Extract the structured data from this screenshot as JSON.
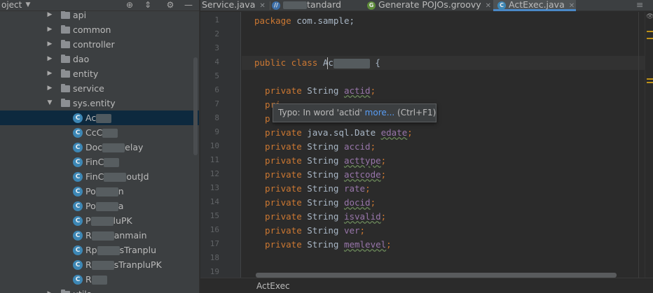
{
  "project_panel": {
    "title": "oject",
    "tree": [
      {
        "kind": "folder",
        "label": "api",
        "expanded": false
      },
      {
        "kind": "folder",
        "label": "common",
        "expanded": false
      },
      {
        "kind": "folder",
        "label": "controller",
        "expanded": false
      },
      {
        "kind": "folder",
        "label": "dao",
        "expanded": false
      },
      {
        "kind": "folder",
        "label": "entity",
        "expanded": false
      },
      {
        "kind": "folder",
        "label": "service",
        "expanded": false
      },
      {
        "kind": "folder",
        "label": "sys.entity",
        "expanded": true
      },
      {
        "kind": "class",
        "label": "Ac",
        "selected": true
      },
      {
        "kind": "class",
        "label": "CcC"
      },
      {
        "kind": "class",
        "label": "Doc",
        "suffix": "elay"
      },
      {
        "kind": "class",
        "label": "FinC"
      },
      {
        "kind": "class",
        "label": "FinC",
        "suffix": "outJd"
      },
      {
        "kind": "class",
        "label": "Po",
        "suffix": "n"
      },
      {
        "kind": "class",
        "label": "Po",
        "suffix": "a"
      },
      {
        "kind": "class",
        "label": "P",
        "suffix": "luPK"
      },
      {
        "kind": "class",
        "label": "R",
        "suffix": "anmain"
      },
      {
        "kind": "class",
        "label": "Rp",
        "suffix": "sTranplu"
      },
      {
        "kind": "class",
        "label": "R",
        "suffix": "sTranpluPK"
      },
      {
        "kind": "class",
        "label": "R"
      },
      {
        "kind": "folder",
        "label": "utils",
        "expanded": false
      }
    ]
  },
  "tabs": [
    {
      "label": "Service.java",
      "icon": "none",
      "active": false
    },
    {
      "label": "tandard",
      "icon": "class-icon",
      "active": false
    },
    {
      "label": "Generate POJOs.groovy",
      "icon": "groovy-icon",
      "active": false
    },
    {
      "label": "ActExec.java",
      "icon": "class-icon",
      "active": true
    }
  ],
  "tab_overflow": "≡",
  "gutter": {
    "line_numbers": [
      "1",
      "2",
      "3",
      "4",
      "5",
      "6",
      "7",
      "8",
      "9",
      "10",
      "11",
      "12",
      "13",
      "14",
      "15",
      "16",
      "17",
      "18",
      "19"
    ]
  },
  "code_lines": [
    {
      "n": 1,
      "parts": [
        {
          "t": "package",
          "c": "kw"
        },
        {
          "t": " com.sample;",
          "c": "plain"
        }
      ]
    },
    {
      "n": 2,
      "parts": []
    },
    {
      "n": 3,
      "parts": []
    },
    {
      "n": 4,
      "parts": [
        {
          "t": "public class",
          "c": "kw"
        },
        {
          "t": " Ac",
          "c": "plain"
        },
        {
          "t": "      ",
          "c": "blur"
        },
        {
          "t": " {",
          "c": "plain"
        }
      ]
    },
    {
      "n": 5,
      "parts": []
    },
    {
      "n": 6,
      "parts": [
        {
          "t": "  private",
          "c": "kw"
        },
        {
          "t": " String ",
          "c": "plain"
        },
        {
          "t": "actid",
          "c": "fld-typo"
        },
        {
          "t": ";",
          "c": "kw"
        }
      ]
    },
    {
      "n": 7,
      "parts": [
        {
          "t": "  pri",
          "c": "kw"
        }
      ]
    },
    {
      "n": 8,
      "parts": [
        {
          "t": "  p",
          "c": "kw"
        }
      ]
    },
    {
      "n": 9,
      "parts": [
        {
          "t": "  private",
          "c": "kw"
        },
        {
          "t": " java.sql.Date ",
          "c": "plain"
        },
        {
          "t": "edate",
          "c": "fld-typo"
        },
        {
          "t": ";",
          "c": "kw"
        }
      ]
    },
    {
      "n": 10,
      "parts": [
        {
          "t": "  private",
          "c": "kw"
        },
        {
          "t": " String ",
          "c": "plain"
        },
        {
          "t": "accid",
          "c": "fld"
        },
        {
          "t": ";",
          "c": "kw"
        }
      ]
    },
    {
      "n": 11,
      "parts": [
        {
          "t": "  private",
          "c": "kw"
        },
        {
          "t": " String ",
          "c": "plain"
        },
        {
          "t": "acttype",
          "c": "fld-typo"
        },
        {
          "t": ";",
          "c": "kw"
        }
      ]
    },
    {
      "n": 12,
      "parts": [
        {
          "t": "  private",
          "c": "kw"
        },
        {
          "t": " String ",
          "c": "plain"
        },
        {
          "t": "actcode",
          "c": "fld-typo"
        },
        {
          "t": ";",
          "c": "kw"
        }
      ]
    },
    {
      "n": 13,
      "parts": [
        {
          "t": "  private",
          "c": "kw"
        },
        {
          "t": " String ",
          "c": "plain"
        },
        {
          "t": "rate",
          "c": "fld"
        },
        {
          "t": ";",
          "c": "kw"
        }
      ]
    },
    {
      "n": 14,
      "parts": [
        {
          "t": "  private",
          "c": "kw"
        },
        {
          "t": " String ",
          "c": "plain"
        },
        {
          "t": "docid",
          "c": "fld-typo"
        },
        {
          "t": ";",
          "c": "kw"
        }
      ]
    },
    {
      "n": 15,
      "parts": [
        {
          "t": "  private",
          "c": "kw"
        },
        {
          "t": " String ",
          "c": "plain"
        },
        {
          "t": "isvalid",
          "c": "fld-typo"
        },
        {
          "t": ";",
          "c": "kw"
        }
      ]
    },
    {
      "n": 16,
      "parts": [
        {
          "t": "  private",
          "c": "kw"
        },
        {
          "t": " String ",
          "c": "plain"
        },
        {
          "t": "ver",
          "c": "fld"
        },
        {
          "t": ";",
          "c": "kw"
        }
      ]
    },
    {
      "n": 17,
      "parts": [
        {
          "t": "  private",
          "c": "kw"
        },
        {
          "t": " String ",
          "c": "plain"
        },
        {
          "t": "memlevel",
          "c": "fld-typo"
        },
        {
          "t": ";",
          "c": "kw"
        }
      ]
    },
    {
      "n": 18,
      "parts": []
    },
    {
      "n": 19,
      "parts": []
    }
  ],
  "tooltip": {
    "prefix": "Typo: In word 'actid' ",
    "link": "more...",
    "suffix": " (Ctrl+F1)"
  },
  "breadcrumb": {
    "label": "ActExec"
  },
  "colors": {
    "keyword": "#cc7832",
    "field": "#9876aa",
    "selection": "#0d293e",
    "accent": "#4a88c7"
  }
}
